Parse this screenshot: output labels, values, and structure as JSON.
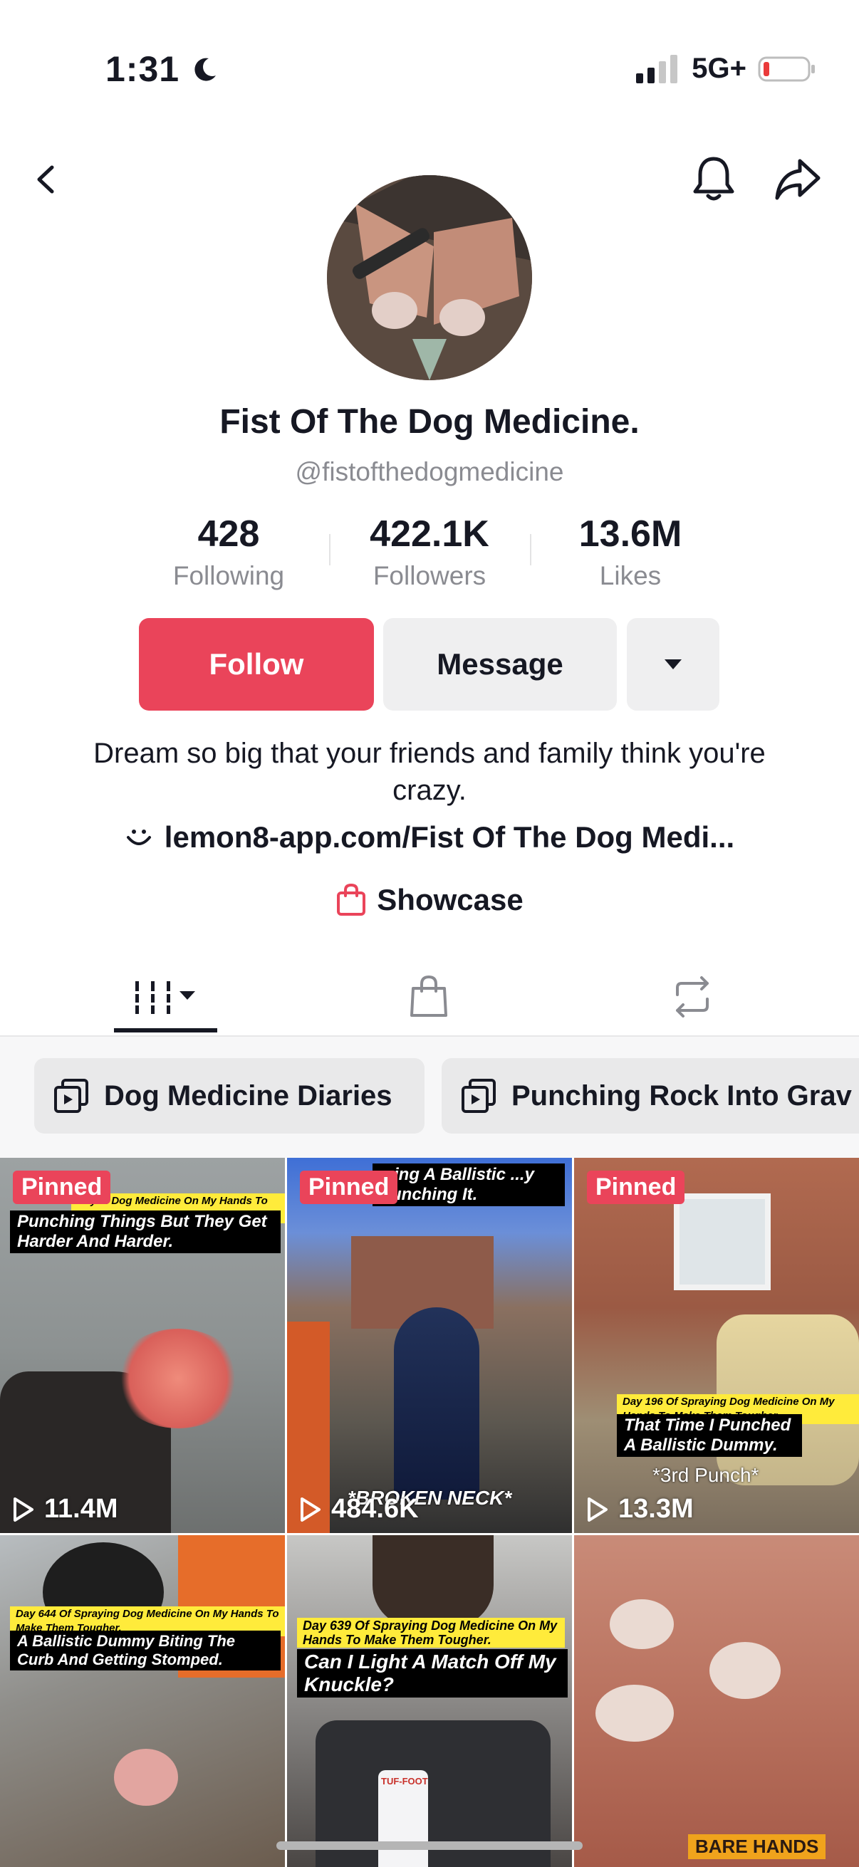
{
  "status_bar": {
    "time": "1:31",
    "network": "5G+"
  },
  "profile": {
    "name": "Fist Of The Dog Medicine.",
    "handle": "@fistofthedogmedicine",
    "stats": [
      {
        "value": "428",
        "label": "Following"
      },
      {
        "value": "422.1K",
        "label": "Followers"
      },
      {
        "value": "13.6M",
        "label": "Likes"
      }
    ],
    "actions": {
      "follow": "Follow",
      "message": "Message"
    },
    "bio": "Dream so big that your friends and family think you're crazy.",
    "link": "lemon8-app.com/Fist Of The Dog Medi...",
    "showcase": "Showcase"
  },
  "playlists": [
    "Dog Medicine Diaries",
    "Punching Rock Into Grav"
  ],
  "videos": [
    {
      "pinned": "Pinned",
      "views": "11.4M",
      "cap_small": "Day ... Dog Medicine On My Hands To Make Them Tougher.",
      "cap_main": "Punching Things But They Get Harder And Harder."
    },
    {
      "pinned": "Pinned",
      "views": "484.6K",
      "cap_main": "...ing A Ballistic ...y Punching It.",
      "overlay": "*BROKEN NECK*"
    },
    {
      "pinned": "Pinned",
      "views": "13.3M",
      "cap_small": "Day 196 Of Spraying Dog Medicine On My Hands To Make Them Tougher.",
      "cap_main": "That Time I Punched A Ballistic Dummy.",
      "overlay": "*3rd Punch*"
    },
    {
      "cap_small": "Day 644 Of Spraying Dog Medicine On My Hands To Make Them Tougher.",
      "cap_main": "A Ballistic Dummy Biting The Curb And Getting Stomped."
    },
    {
      "cap_small": "Day 639 Of Spraying Dog Medicine On My Hands To Make Them Tougher.",
      "cap_main": "Can I Light A Match Off My Knuckle?",
      "product": "TUF-FOOT"
    },
    {
      "overlay": "BARE HANDS"
    }
  ]
}
